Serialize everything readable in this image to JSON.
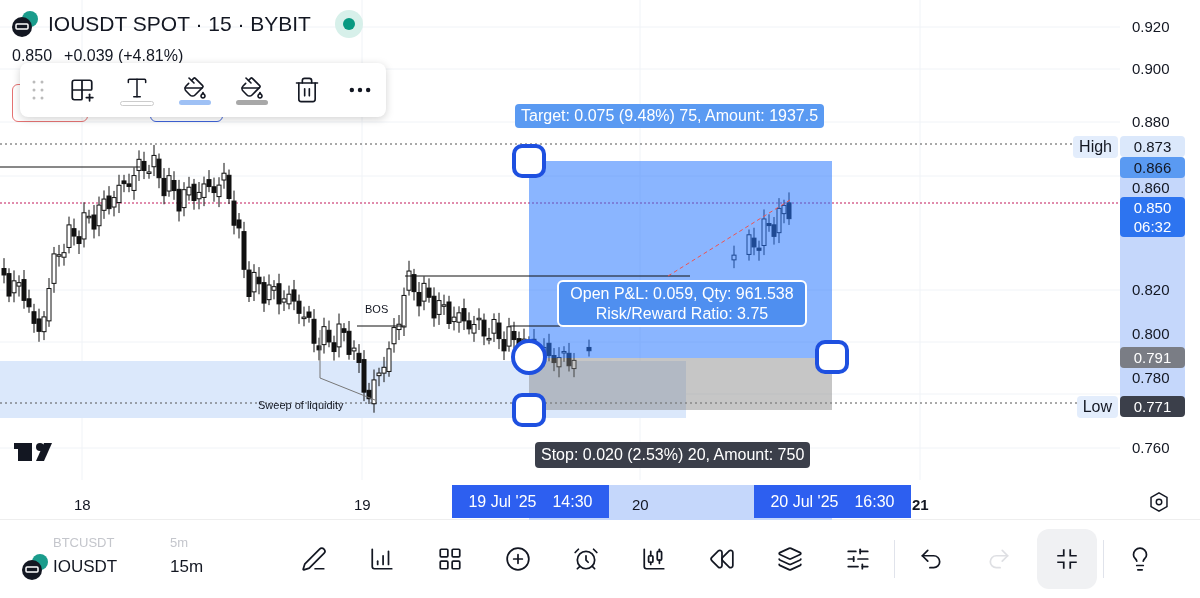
{
  "header": {
    "title": "IOUSDT SPOT · 15 · BYBIT",
    "price": "0.850",
    "change": "+0.039 (+4.81%)",
    "live": true
  },
  "price_axis": {
    "ticks": [
      "0.920",
      "0.900",
      "0.880",
      "0.860",
      "0.820",
      "0.800",
      "0.780",
      "0.760"
    ],
    "markers": [
      {
        "kind": "high",
        "text": "0.873",
        "tag": "High"
      },
      {
        "kind": "target",
        "text": "0.866"
      },
      {
        "kind": "current",
        "text": "0.850",
        "countdown": "06:32"
      },
      {
        "kind": "entry",
        "text": "0.791"
      },
      {
        "kind": "low",
        "text": "0.771",
        "tag": "Low"
      }
    ]
  },
  "position": {
    "target_label": "Target: 0.075 (9.48%) 75, Amount: 1937.5",
    "info": [
      "Open P&L: 0.059, Qty: 961.538",
      "Risk/Reward Ratio: 3.75"
    ],
    "stop_label": "Stop: 0.020 (2.53%) 20, Amount: 750"
  },
  "annotations": [
    {
      "kind": "bos",
      "text": "BOS"
    },
    {
      "kind": "sweep",
      "text": "Sweep of liquidity"
    }
  ],
  "time_axis": {
    "ticks": [
      {
        "text": "18",
        "bold": false
      },
      {
        "text": "19",
        "bold": false
      },
      {
        "text": "20",
        "bold": false
      },
      {
        "text": "21",
        "bold": true
      }
    ],
    "range_labels": [
      {
        "date": "19 Jul '25",
        "time": "14:30"
      },
      {
        "date": "20 Jul '25",
        "time": "16:30"
      }
    ]
  },
  "bottom_bar": {
    "symbols": [
      {
        "name": "BTCUSDT",
        "interval": "5m",
        "selected": false
      },
      {
        "name": "IOUSDT",
        "interval": "15m",
        "selected": true
      }
    ],
    "tools": [
      {
        "kind": "draw",
        "disabled": false,
        "selected": false
      },
      {
        "kind": "indicators",
        "disabled": false,
        "selected": false
      },
      {
        "kind": "layouts",
        "disabled": false,
        "selected": false
      },
      {
        "kind": "add",
        "disabled": false,
        "selected": false
      },
      {
        "kind": "alert",
        "disabled": false,
        "selected": false
      },
      {
        "kind": "candles",
        "disabled": false,
        "selected": false
      },
      {
        "kind": "replay",
        "disabled": false,
        "selected": false
      },
      {
        "kind": "layers",
        "disabled": false,
        "selected": false
      },
      {
        "kind": "settings",
        "disabled": false,
        "selected": false
      },
      {
        "kind": "undo",
        "disabled": false,
        "selected": false
      },
      {
        "kind": "redo",
        "disabled": true,
        "selected": false
      },
      {
        "kind": "collapse",
        "disabled": false,
        "selected": true
      },
      {
        "kind": "idea",
        "disabled": false,
        "selected": false
      }
    ]
  }
}
